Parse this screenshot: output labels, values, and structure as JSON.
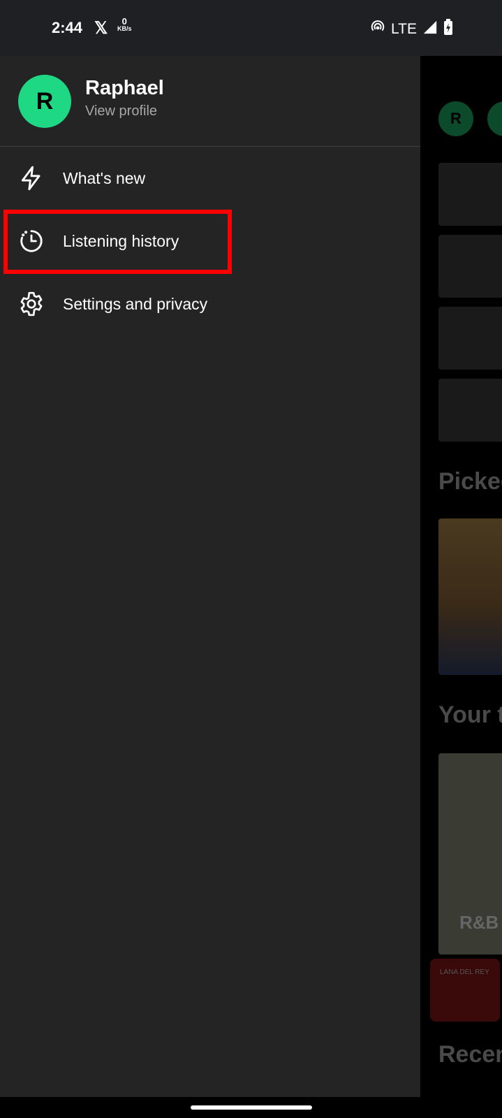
{
  "status_bar": {
    "time": "2:44",
    "x_icon": "x-logo-icon",
    "speed_value": "0",
    "speed_unit": "KB/s",
    "network": "LTE",
    "icons": [
      "hotspot-icon",
      "signal-icon",
      "battery-charging-icon"
    ]
  },
  "profile": {
    "initial": "R",
    "name": "Raphael",
    "link": "View profile",
    "avatar_color": "#1ed883"
  },
  "menu": {
    "items": [
      {
        "label": "What's new",
        "icon": "lightning-icon"
      },
      {
        "label": "Listening history",
        "icon": "history-clock-icon"
      },
      {
        "label": "Settings and privacy",
        "icon": "gear-icon"
      }
    ]
  },
  "background": {
    "avatar_initial": "R",
    "headings": [
      "Picked",
      "Your t",
      "Recen"
    ],
    "card_label": "R&B",
    "now_playing": "LANA DEL REY"
  },
  "highlight_color": "#ff0000"
}
